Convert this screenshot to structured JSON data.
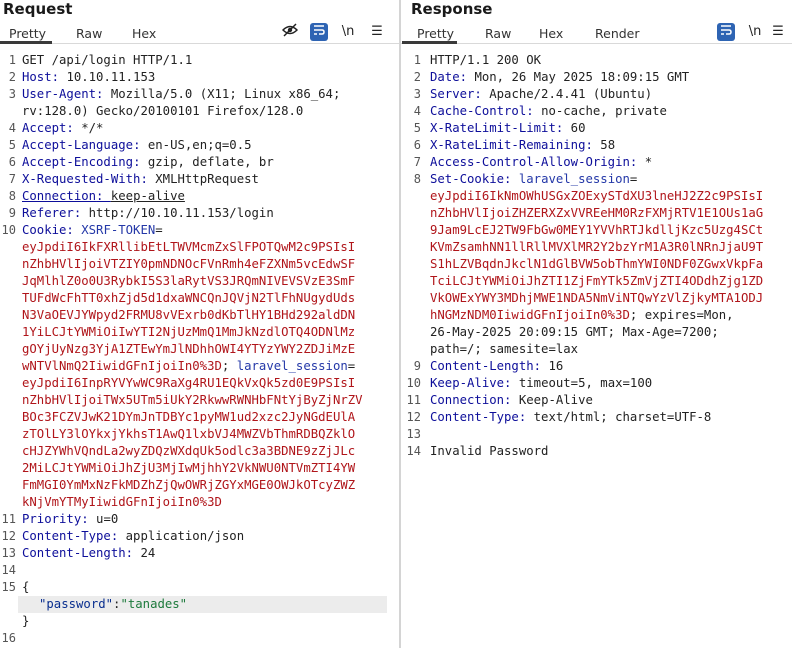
{
  "request": {
    "title": "Request",
    "tabs": [
      "Pretty",
      "Raw",
      "Hex"
    ],
    "line_numbers": [
      "1",
      "2",
      "3",
      "",
      "4",
      "5",
      "6",
      "7",
      "8",
      "9",
      "10",
      "",
      "",
      "",
      "",
      "",
      "",
      "",
      "",
      "",
      "",
      "",
      "",
      "",
      "",
      "",
      "",
      "",
      "",
      "",
      "11",
      "12",
      "13",
      "14",
      "15",
      "",
      "16"
    ],
    "lines": {
      "l1": "GET /api/login HTTP/1.1",
      "l2k": "Host",
      "l2v": "10.10.11.153",
      "l3k": "User-Agent",
      "l3v": "Mozilla/5.0 (X11; Linux x86_64;",
      "l3b": "rv:128.0) Gecko/20100101 Firefox/128.0",
      "l4k": "Accept",
      "l4v": "*/*",
      "l5k": "Accept-Language",
      "l5v": "en-US,en;q=0.5",
      "l6k": "Accept-Encoding",
      "l6v": "gzip, deflate, br",
      "l7k": "X-Requested-With",
      "l7v": "XMLHttpRequest",
      "l8k": "Connection",
      "l8v": "keep-alive",
      "l9k": "Referer",
      "l9v": "http://10.10.11.153/login",
      "l10k": "Cookie",
      "l10c1": "XSRF-TOKEN",
      "c1": "eyJpdiI6IkFXRllibEtLTWVMcmZxSlFPOTQwM2c9PSIsI",
      "c2": "nZhbHVlIjoiVTZIY0pmNDNOcFVnRmh4eFZXNm5vcEdwSF",
      "c3": "JqMlhlZ0o0U3RybkI5S3laRytVS3JRQmNIVEVSVzE3SmF",
      "c4": "TUFdWcFhTT0xhZjd5d1dxaWNCQnJQVjN2TlFhNUgydUds",
      "c5": "N3VaOEVJYWpyd2FRMU8vVExrb0dKbTlHY1BHd292aldDN",
      "c6": "1YiLCJtYWMiOiIwYTI2NjUzMmQ1MmJkNzdlOTQ4ODNlMz",
      "c7": "gOYjUyNzg3YjA1ZTEwYmJlNDhhOWI4YTYzYWY2ZDJiMzE",
      "c8": "wNTVlNmQ2IiwidGFnIjoiIn0%3D",
      "c8b": "laravel_session",
      "c9": "eyJpdiI6InpRYVYwWC9RaXg4RU1EQkVxQk5zd0E9PSIsI",
      "c10": "nZhbHVlIjoiTWx5UTm5iUkY2RkwwRWNHbFNtYjByZjNrZV",
      "c11": "BOc3FCZVJwK21DYmJnTDBYc1pyMW1ud2xzc2JyNGdEUlA",
      "c12": "zTOlLY3lOYkxjYkhsT1AwQ1lxbVJ4MWZVbThmRDBQZklO",
      "c13": "cHJZYWhVQndLa2wyZDQzWXdqUk5odlc3a3BDNE9zZjJLc",
      "c14": "2MiLCJtYWMiOiJhZjU3MjIwMjhhY2VkNWU0NTVmZTI4YW",
      "c15": "FmMGI0YmMxNzFkMDZhZjQwOWRjZGYxMGE0OWJkOTcyZWZ",
      "c16": "kNjVmYTMyIiwidGFnIjoiIn0%3D",
      "l11k": "Priority",
      "l11v": "u=0",
      "l12k": "Content-Type",
      "l12v": "application/json",
      "l13k": "Content-Length",
      "l13v": "24",
      "l15": "{",
      "jk": "\"password\"",
      "jv": "\"tanades\"",
      "close": "}"
    }
  },
  "response": {
    "title": "Response",
    "tabs": [
      "Pretty",
      "Raw",
      "Hex",
      "Render"
    ],
    "lines": {
      "l1": "HTTP/1.1 200 OK",
      "l2k": "Date",
      "l2v": "Mon, 26 May 2025 18:09:15 GMT",
      "l3k": "Server",
      "l3v": "Apache/2.4.41 (Ubuntu)",
      "l4k": "Cache-Control",
      "l4v": "no-cache, private",
      "l5k": "X-RateLimit-Limit",
      "l5v": "60",
      "l6k": "X-RateLimit-Remaining",
      "l6v": "58",
      "l7k": "Access-Control-Allow-Origin",
      "l7v": "*",
      "l8k": "Set-Cookie",
      "l8c": "laravel_session",
      "s1": "eyJpdiI6IkNmOWhUSGxZOExySTdXU3lneHJ2Z2c9PSIsI",
      "s2": "nZhbHVlIjoiZHZERXZxVVREeHM0RzFXMjRTV1E1OUs1aG",
      "s3": "9Jam9LcEJ2TW9FbGw0MEY1YVVhRTJkdlljKzc5Uzg4SCt",
      "s4": "KVmZsamhNN1llRllMVXlMR2Y2bzYrM1A3R0lNRnJjaU9T",
      "s5": "S1hLZVBqdnJkclN1dGlBVW5obThmYWI0NDF0ZGwxVkpFa",
      "s6": "TciLCJtYWMiOiJhZTI1ZjFmYTk5ZmVjZTI4ODdhZjg1ZD",
      "s7": "VkOWExYWY3MDhjMWE1NDA5NmViNTQwYzVlZjkyMTA1ODJ",
      "s8": "hNGMzNDM0IiwidGFnIjoiIn0%3D",
      "s8b": "; expires=Mon,",
      "s9": "26-May-2025 20:09:15 GMT; Max-Age=7200;",
      "s10": "path=/; samesite=lax",
      "l9k": "Content-Length",
      "l9v": "16",
      "l10k": "Keep-Alive",
      "l10v": "timeout=5, max=100",
      "l11k": "Connection",
      "l11v": "Keep-Alive",
      "l12k": "Content-Type",
      "l12v": "text/html; charset=UTF-8",
      "l14": "Invalid Password"
    }
  }
}
